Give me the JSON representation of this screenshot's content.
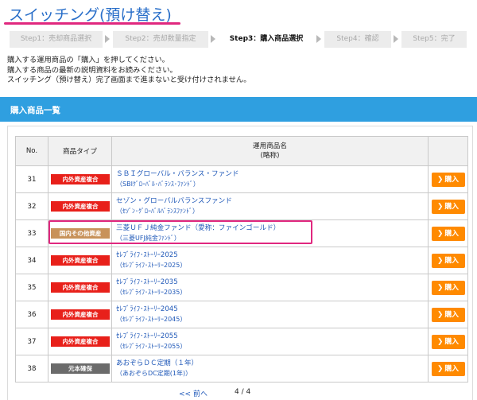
{
  "page": {
    "title": "スイッチング(預け替え)"
  },
  "steps": [
    {
      "label": "Step1：売却商品選択",
      "active": false
    },
    {
      "label": "Step2：売却数量指定",
      "active": false
    },
    {
      "label": "Step3：購入商品選択",
      "active": true
    },
    {
      "label": "Step4：確認",
      "active": false
    },
    {
      "label": "Step5：完了",
      "active": false
    }
  ],
  "instructions": [
    "購入する運用商品の「購入」を押してください。",
    "購入する商品の最新の説明資料をお読みください。",
    "スイッチング（預け替え）完了画面まで進まないと受け付けされません。"
  ],
  "section": {
    "title": "購入商品一覧"
  },
  "table": {
    "headers": {
      "no": "No.",
      "type": "商品タイプ",
      "name_line1": "運用商品名",
      "name_line2": "(略称)"
    },
    "rows": [
      {
        "no": "31",
        "type": "内外資産複合",
        "type_color": "red",
        "name": "ＳＢＩグローバル・バランス・ファンド",
        "short": "（SBIｸﾞﾛｰﾊﾞﾙ･ﾊﾞﾗﾝｽ･ﾌｧﾝﾄﾞ）",
        "action": "購入"
      },
      {
        "no": "32",
        "type": "内外資産複合",
        "type_color": "red",
        "name": "セゾン・グローバルバランスファンド",
        "short": "（ｾｿﾞﾝ･ｸﾞﾛｰﾊﾞﾙﾊﾞﾗﾝｽﾌｧﾝﾄﾞ）",
        "action": "購入"
      },
      {
        "no": "33",
        "type": "国内その他資産",
        "type_color": "tan",
        "name": "三菱ＵＦＪ純金ファンド（愛称：ファインゴールド）",
        "short": "（三菱UFJ純金ﾌｧﾝﾄﾞ）",
        "action": "購入"
      },
      {
        "no": "34",
        "type": "内外資産複合",
        "type_color": "red",
        "name": "ｾﾚﾌﾞﾗｲﾌ･ｽﾄｰﾘｰ2025",
        "short": "（ｾﾚﾌﾞﾗｲﾌ･ｽﾄｰﾘｰ2025）",
        "action": "購入"
      },
      {
        "no": "35",
        "type": "内外資産複合",
        "type_color": "red",
        "name": "ｾﾚﾌﾞﾗｲﾌ･ｽﾄｰﾘｰ2035",
        "short": "（ｾﾚﾌﾞﾗｲﾌ･ｽﾄｰﾘｰ2035）",
        "action": "購入"
      },
      {
        "no": "36",
        "type": "内外資産複合",
        "type_color": "red",
        "name": "ｾﾚﾌﾞﾗｲﾌ･ｽﾄｰﾘｰ2045",
        "short": "（ｾﾚﾌﾞﾗｲﾌ･ｽﾄｰﾘｰ2045）",
        "action": "購入"
      },
      {
        "no": "37",
        "type": "内外資産複合",
        "type_color": "red",
        "name": "ｾﾚﾌﾞﾗｲﾌ･ｽﾄｰﾘｰ2055",
        "short": "（ｾﾚﾌﾞﾗｲﾌ･ｽﾄｰﾘｰ2055）",
        "action": "購入"
      },
      {
        "no": "38",
        "type": "元本確保",
        "type_color": "gray",
        "name": "あおぞらＤＣ定期（１年）",
        "short": "（あおぞらDC定期(1年)）",
        "action": "購入"
      }
    ]
  },
  "pagination": {
    "prev": "<< 前へ",
    "page": "4 / 4"
  },
  "colors": {
    "accent_blue": "#2f9fe0",
    "title_blue": "#2a6fc9",
    "highlight_pink": "#e0287f",
    "buy_orange": "#ff8a00",
    "badge_red": "#e8201a",
    "badge_tan": "#c8925a",
    "badge_gray": "#6b6b6b"
  }
}
